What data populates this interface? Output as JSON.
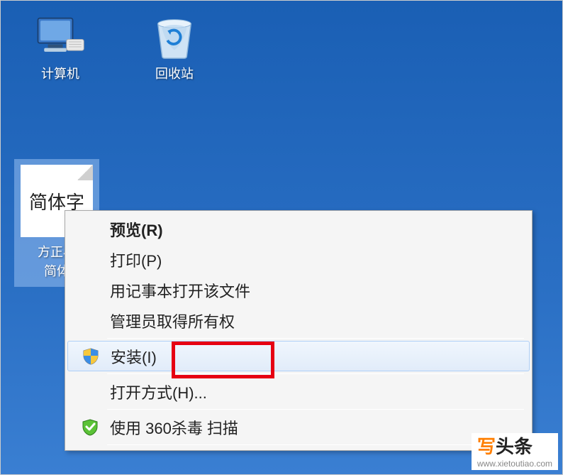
{
  "desktop": {
    "computer_label": "计算机",
    "recycle_label": "回收站",
    "font_file_thumb_text": "简体字",
    "font_file_label": "方正小\n简体"
  },
  "context_menu": {
    "items": [
      {
        "label": "预览(R)",
        "icon": "",
        "default": true
      },
      {
        "label": "打印(P)",
        "icon": ""
      },
      {
        "label": "用记事本打开该文件",
        "icon": ""
      },
      {
        "label": "管理员取得所有权",
        "icon": ""
      },
      {
        "label": "安装(I)",
        "icon": "uac-shield",
        "hover": true,
        "highlighted": true
      },
      {
        "label": "打开方式(H)...",
        "icon": ""
      },
      {
        "label": "使用 360杀毒 扫描",
        "icon": "av-shield"
      }
    ]
  },
  "watermark": {
    "brand1": "写",
    "brand2": "头条",
    "url": "www.xietoutiao.com"
  }
}
